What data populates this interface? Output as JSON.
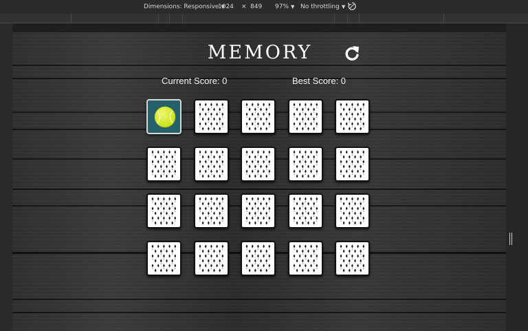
{
  "devtools": {
    "dimensions_label": "Dimensions: Responsive",
    "width_value": "1024",
    "times": "×",
    "height_value": "849",
    "zoom_label": "97%",
    "throttle_label": "No throttling",
    "rotate_icon": "rotate-icon"
  },
  "game": {
    "title": "MEMORY",
    "restart_icon": "restart-icon",
    "current_score": "Current Score: 0",
    "best_score": "Best Score: 0",
    "rows": 4,
    "cols": 5,
    "cards": [
      {
        "state": "revealed",
        "face": "tennis-ball-icon"
      },
      {
        "state": "hidden"
      },
      {
        "state": "hidden"
      },
      {
        "state": "hidden"
      },
      {
        "state": "hidden"
      },
      {
        "state": "hidden"
      },
      {
        "state": "hidden"
      },
      {
        "state": "hidden"
      },
      {
        "state": "hidden"
      },
      {
        "state": "hidden"
      },
      {
        "state": "hidden"
      },
      {
        "state": "hidden"
      },
      {
        "state": "hidden"
      },
      {
        "state": "hidden"
      },
      {
        "state": "hidden"
      },
      {
        "state": "hidden"
      },
      {
        "state": "hidden"
      },
      {
        "state": "hidden"
      },
      {
        "state": "hidden"
      },
      {
        "state": "hidden"
      }
    ]
  },
  "colors": {
    "card_back": "#ffffff",
    "revealed_bg": "#26606b",
    "ball": "#c8e01a"
  }
}
